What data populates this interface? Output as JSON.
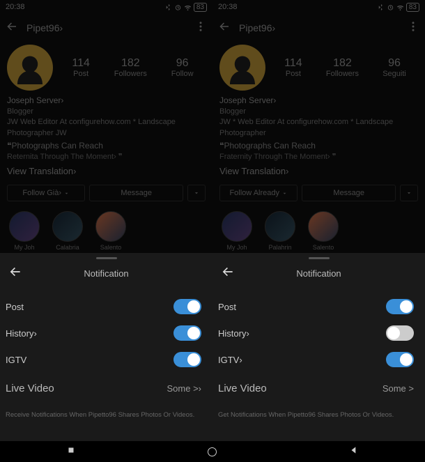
{
  "statusbar": {
    "time": "20:38"
  },
  "left": {
    "username": "Pipet96›",
    "stats": {
      "posts_num": "114",
      "posts_lbl": "Post",
      "followers_num": "182",
      "followers_lbl": "Followers",
      "following_num": "96",
      "following_lbl": "Follow"
    },
    "bio": {
      "name": "Joseph Server›",
      "role": "Blogger",
      "desc": "JW Web Editor At configurehow.com * Landscape Photographer JW",
      "tagline": "❝Photographs Can Reach",
      "sub": "Reternita Through The Moment› ❞",
      "translate": "View Translation›"
    },
    "actions": {
      "follow": "Follow Già›",
      "message": "Message"
    },
    "stories": [
      "My Joh",
      "Calabria",
      "Salento"
    ],
    "sheet": {
      "title": "Notification",
      "items": {
        "post": {
          "label": "Post",
          "on": true
        },
        "history": {
          "label": "History›",
          "on": true
        },
        "igtv": {
          "label": "IGTV",
          "on": true
        }
      },
      "live": {
        "label": "Live Video",
        "value": "Some >›"
      },
      "note": "Receive Notifications When Pipetto96 Shares Photos Or Videos."
    }
  },
  "right": {
    "username": "Pipet96›",
    "stats": {
      "posts_num": "114",
      "posts_lbl": "Post",
      "followers_num": "182",
      "followers_lbl": "Followers",
      "following_num": "96",
      "following_lbl": "Seguiti"
    },
    "bio": {
      "name": "Joseph Server›",
      "role": "Blogger",
      "desc": "JW * Web Editor At configurehow.com * Landscape Photographer",
      "tagline": "❝Photographs Can Reach",
      "sub": "Fraternity Through The Moment› ❞",
      "translate": "View Translation›"
    },
    "actions": {
      "follow": "Follow Already",
      "message": "Message"
    },
    "stories": [
      "My Joh",
      "Palahrin",
      "Salento"
    ],
    "sheet": {
      "title": "Notification",
      "items": {
        "post": {
          "label": "Post",
          "on": true
        },
        "history": {
          "label": "History›",
          "on": false
        },
        "igtv": {
          "label": "IGTV›",
          "on": true
        }
      },
      "live": {
        "label": "Live Video",
        "value": "Some >"
      },
      "note": "Get Notifications When Pipetto96 Shares Photos Or Videos."
    }
  }
}
